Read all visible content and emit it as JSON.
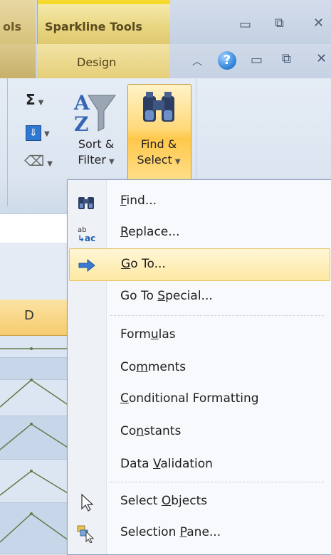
{
  "titlebar": {
    "left_tab_fragment": "ols",
    "context_group": "Sparkline Tools"
  },
  "tabs": {
    "design": "Design"
  },
  "ribbon": {
    "sort_label_1": "Sort &",
    "sort_label_2": "Filter",
    "find_label_1": "Find &",
    "find_label_2": "Select"
  },
  "sheet": {
    "column": "D"
  },
  "menu": {
    "items": [
      {
        "pre": "",
        "ul": "F",
        "post": "ind...",
        "icon": "binoculars-icon"
      },
      {
        "pre": "",
        "ul": "R",
        "post": "eplace...",
        "icon": "replace-icon"
      },
      {
        "pre": "",
        "ul": "G",
        "post": "o To...",
        "icon": "arrow-right-icon",
        "highlighted": true
      },
      {
        "pre": "Go To ",
        "ul": "S",
        "post": "pecial...",
        "icon": ""
      },
      {
        "pre": "Form",
        "ul": "u",
        "post": "las",
        "icon": ""
      },
      {
        "pre": "Co",
        "ul": "m",
        "post": "ments",
        "icon": ""
      },
      {
        "pre": "",
        "ul": "C",
        "post": "onditional Formatting",
        "icon": ""
      },
      {
        "pre": "Co",
        "ul": "n",
        "post": "stants",
        "icon": ""
      },
      {
        "pre": "Data ",
        "ul": "V",
        "post": "alidation",
        "icon": ""
      },
      {
        "pre": "Select ",
        "ul": "O",
        "post": "bjects",
        "icon": "cursor-icon"
      },
      {
        "pre": "Selection ",
        "ul": "P",
        "post": "ane...",
        "icon": "selection-pane-icon"
      }
    ]
  },
  "colors": {
    "highlight": "#fde9a3",
    "context_tab": "#f5d92f",
    "accent_blue": "#2b7fd6"
  }
}
